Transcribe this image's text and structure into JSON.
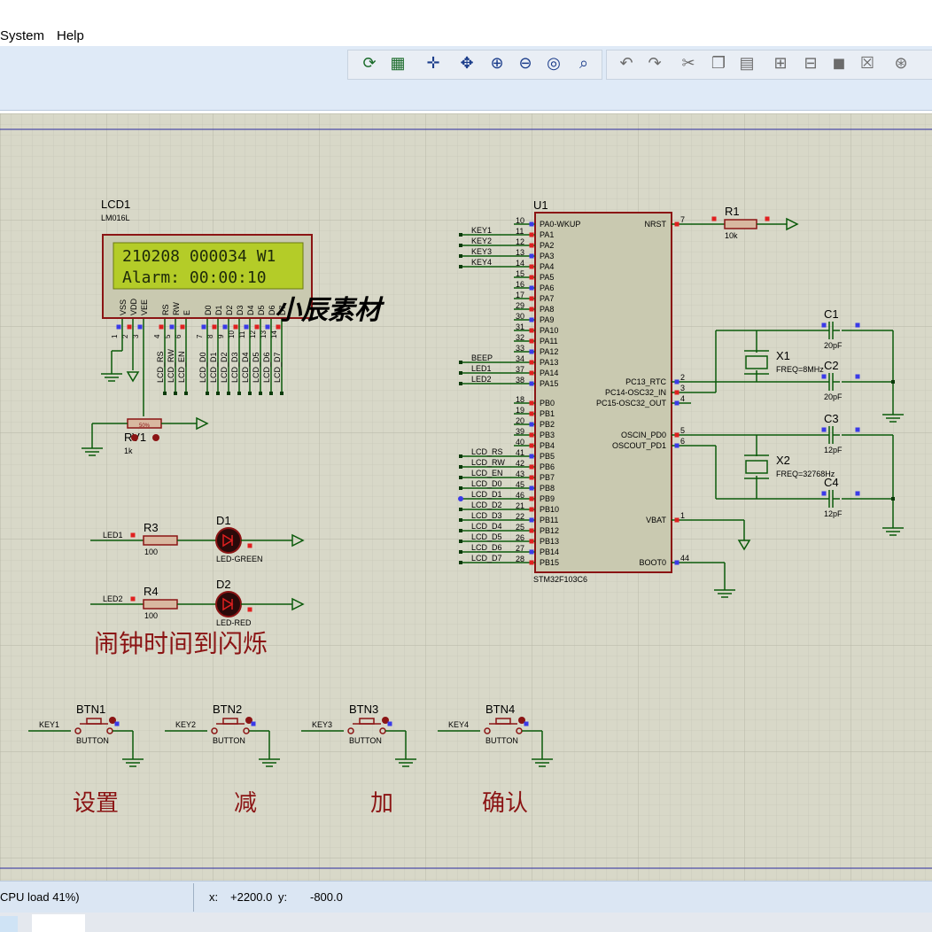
{
  "menu": {
    "system": "System",
    "help": "Help"
  },
  "toolbar": {
    "icons": [
      "refresh-icon",
      "grid-icon",
      "origin-icon",
      "pan-icon",
      "zoom-in-icon",
      "zoom-out-icon",
      "zoom-fit-icon",
      "zoom-area-icon",
      "undo-icon",
      "redo-icon",
      "cut-icon",
      "copy-icon",
      "paste-icon",
      "block-copy-icon",
      "block-move-icon",
      "block-rotate-icon",
      "block-delete-icon",
      "pick-device-icon"
    ]
  },
  "schematic": {
    "lcd": {
      "ref": "LCD1",
      "model": "LM016L",
      "line1": "210208 000034 W1",
      "line2": "Alarm: 00:00:10",
      "pin_names": [
        "VSS",
        "VDD",
        "VEE",
        "RS",
        "RW",
        "E",
        "D0",
        "D1",
        "D2",
        "D3",
        "D4",
        "D5",
        "D6",
        "D7"
      ],
      "pin_nums": [
        "1",
        "2",
        "3",
        "4",
        "5",
        "6",
        "7",
        "8",
        "9",
        "10",
        "11",
        "12",
        "13",
        "14"
      ],
      "net_labels": [
        "LCD_RS",
        "LCD_RW",
        "LCD_EN",
        "LCD_D0",
        "LCD_D1",
        "LCD_D2",
        "LCD_D3",
        "LCD_D4",
        "LCD_D5",
        "LCD_D6",
        "LCD_D7"
      ]
    },
    "watermark": "小辰素材",
    "pot": {
      "ref": "RV1",
      "value": "1k",
      "pct": "50%"
    },
    "r3": {
      "ref": "R3",
      "value": "100",
      "net": "LED1"
    },
    "r4": {
      "ref": "R4",
      "value": "100",
      "net": "LED2"
    },
    "d1": {
      "ref": "D1",
      "model": "LED-GREEN"
    },
    "d2": {
      "ref": "D2",
      "model": "LED-RED"
    },
    "alarm_note": "闹钟时间到闪烁",
    "buttons": [
      {
        "ref": "BTN1",
        "model": "BUTTON",
        "net": "KEY1",
        "caption": "设置"
      },
      {
        "ref": "BTN2",
        "model": "BUTTON",
        "net": "KEY2",
        "caption": "减"
      },
      {
        "ref": "BTN3",
        "model": "BUTTON",
        "net": "KEY3",
        "caption": "加"
      },
      {
        "ref": "BTN4",
        "model": "BUTTON",
        "net": "KEY4",
        "caption": "确认"
      }
    ],
    "mcu": {
      "ref": "U1",
      "model": "STM32F103C6",
      "left_pins": [
        {
          "num": "10",
          "name": "PA0-WKUP",
          "net": ""
        },
        {
          "num": "11",
          "name": "PA1",
          "net": "KEY1"
        },
        {
          "num": "12",
          "name": "PA2",
          "net": "KEY2"
        },
        {
          "num": "13",
          "name": "PA3",
          "net": "KEY3"
        },
        {
          "num": "14",
          "name": "PA4",
          "net": "KEY4"
        },
        {
          "num": "15",
          "name": "PA5",
          "net": ""
        },
        {
          "num": "16",
          "name": "PA6",
          "net": ""
        },
        {
          "num": "17",
          "name": "PA7",
          "net": ""
        },
        {
          "num": "29",
          "name": "PA8",
          "net": ""
        },
        {
          "num": "30",
          "name": "PA9",
          "net": ""
        },
        {
          "num": "31",
          "name": "PA10",
          "net": ""
        },
        {
          "num": "32",
          "name": "PA11",
          "net": ""
        },
        {
          "num": "33",
          "name": "PA12",
          "net": ""
        },
        {
          "num": "34",
          "name": "PA13",
          "net": "BEEP"
        },
        {
          "num": "37",
          "name": "PA14",
          "net": "LED1"
        },
        {
          "num": "38",
          "name": "PA15",
          "net": "LED2"
        },
        {
          "num": "18",
          "name": "PB0",
          "net": ""
        },
        {
          "num": "19",
          "name": "PB1",
          "net": ""
        },
        {
          "num": "20",
          "name": "PB2",
          "net": ""
        },
        {
          "num": "39",
          "name": "PB3",
          "net": ""
        },
        {
          "num": "40",
          "name": "PB4",
          "net": ""
        },
        {
          "num": "41",
          "name": "PB5",
          "net": "LCD_RS"
        },
        {
          "num": "42",
          "name": "PB6",
          "net": "LCD_RW"
        },
        {
          "num": "43",
          "name": "PB7",
          "net": "LCD_EN"
        },
        {
          "num": "45",
          "name": "PB8",
          "net": "LCD_D0"
        },
        {
          "num": "46",
          "name": "PB9",
          "net": "LCD_D1"
        },
        {
          "num": "21",
          "name": "PB10",
          "net": "LCD_D2"
        },
        {
          "num": "22",
          "name": "PB11",
          "net": "LCD_D3"
        },
        {
          "num": "25",
          "name": "PB12",
          "net": "LCD_D4"
        },
        {
          "num": "26",
          "name": "PB13",
          "net": "LCD_D5"
        },
        {
          "num": "27",
          "name": "PB14",
          "net": "LCD_D6"
        },
        {
          "num": "28",
          "name": "PB15",
          "net": "LCD_D7"
        }
      ],
      "right_pins": [
        {
          "num": "7",
          "name": "NRST"
        },
        {
          "num": "2",
          "name": "PC13_RTC"
        },
        {
          "num": "3",
          "name": "PC14-OSC32_IN"
        },
        {
          "num": "4",
          "name": "PC15-OSC32_OUT"
        },
        {
          "num": "5",
          "name": "OSCIN_PD0"
        },
        {
          "num": "6",
          "name": "OSCOUT_PD1"
        },
        {
          "num": "1",
          "name": "VBAT"
        },
        {
          "num": "44",
          "name": "BOOT0"
        }
      ]
    },
    "r1": {
      "ref": "R1",
      "value": "10k"
    },
    "c1": {
      "ref": "C1",
      "value": "20pF"
    },
    "c2": {
      "ref": "C2",
      "value": "20pF"
    },
    "c3": {
      "ref": "C3",
      "value": "12pF"
    },
    "c4": {
      "ref": "C4",
      "value": "12pF"
    },
    "x1": {
      "ref": "X1",
      "freq": "FREQ=8MHz"
    },
    "x2": {
      "ref": "X2",
      "freq": "FREQ=32768Hz"
    }
  },
  "status": {
    "cpu": "CPU load 41%)",
    "x_label": "x:",
    "x_value": "+2200.0",
    "y_label": "y:",
    "y_value": "-800.0"
  }
}
